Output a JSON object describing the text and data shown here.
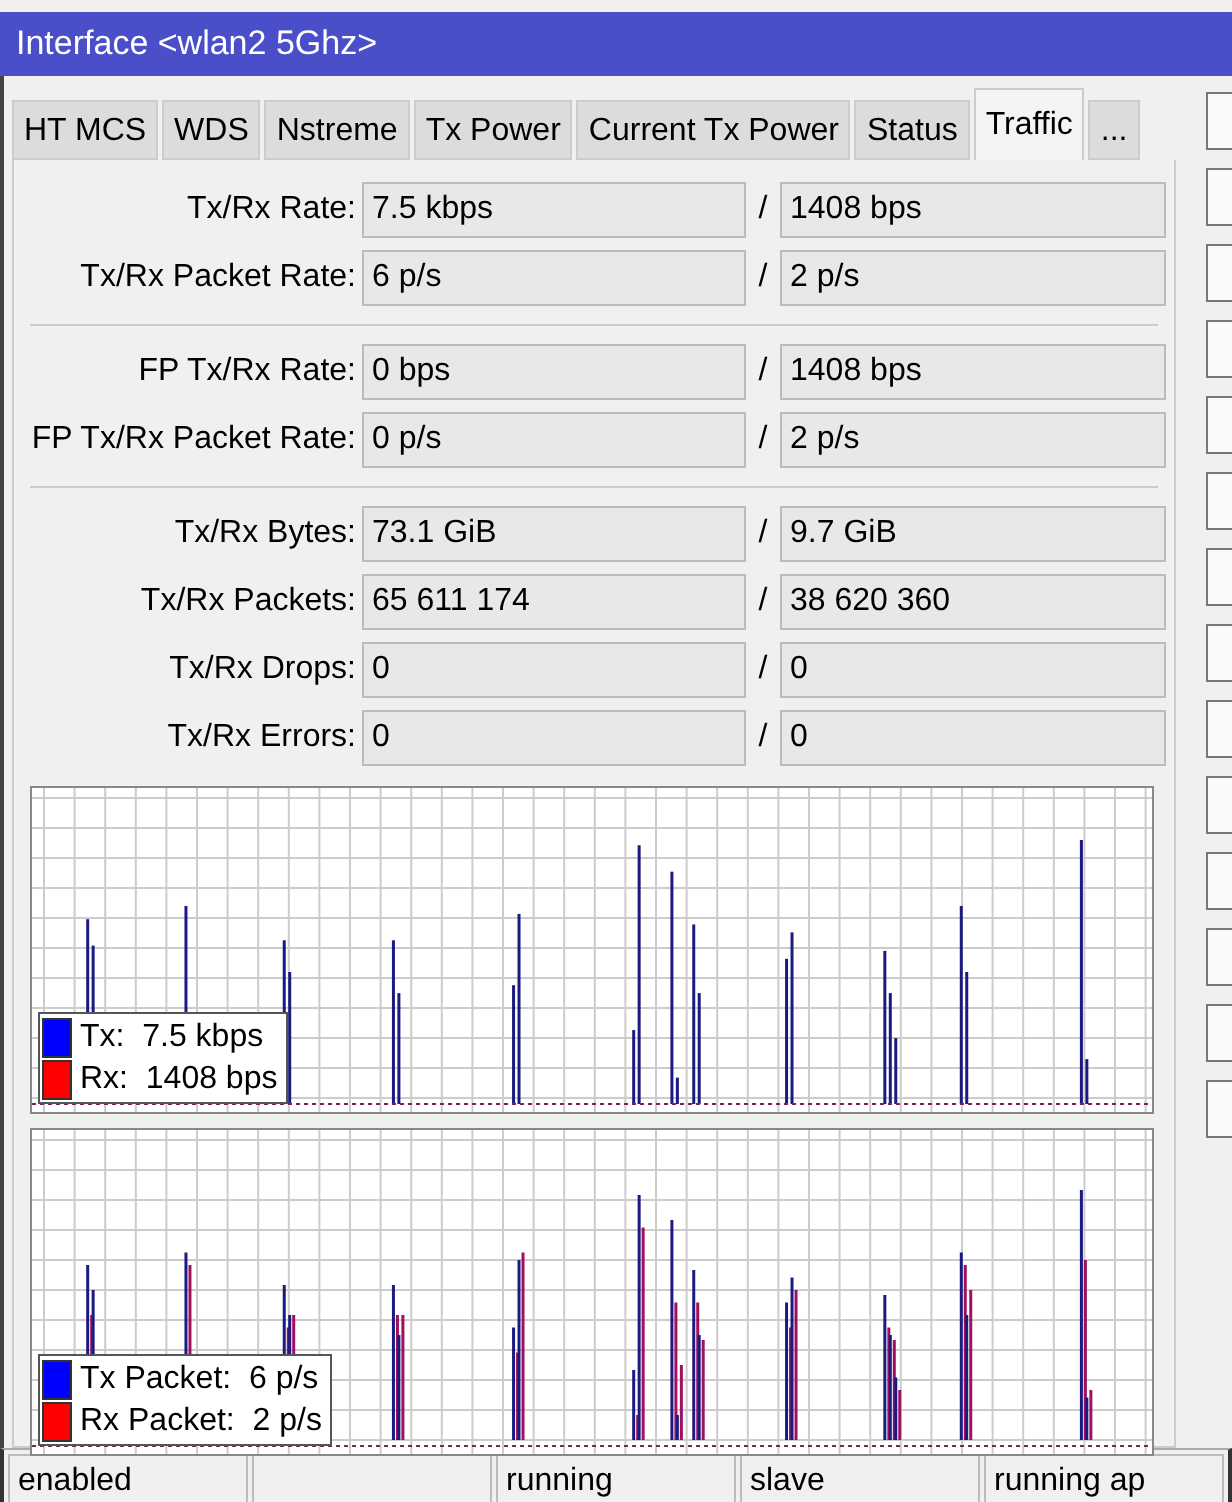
{
  "window": {
    "title": "Interface <wlan2 5Ghz>"
  },
  "tabs": [
    {
      "label": "HT MCS",
      "selected": false
    },
    {
      "label": "WDS",
      "selected": false
    },
    {
      "label": "Nstreme",
      "selected": false
    },
    {
      "label": "Tx Power",
      "selected": false
    },
    {
      "label": "Current Tx Power",
      "selected": false
    },
    {
      "label": "Status",
      "selected": false
    },
    {
      "label": "Traffic",
      "selected": true
    },
    {
      "label": "...",
      "selected": false
    }
  ],
  "groups": [
    [
      {
        "label": "Tx/Rx Rate:",
        "tx": "7.5 kbps",
        "separator": "/",
        "rx": "1408 bps"
      },
      {
        "label": "Tx/Rx Packet Rate:",
        "tx": "6 p/s",
        "separator": "/",
        "rx": "2 p/s"
      }
    ],
    [
      {
        "label": "FP Tx/Rx Rate:",
        "tx": "0 bps",
        "separator": "/",
        "rx": "1408 bps"
      },
      {
        "label": "FP Tx/Rx Packet Rate:",
        "tx": "0 p/s",
        "separator": "/",
        "rx": "2 p/s"
      }
    ],
    [
      {
        "label": "Tx/Rx Bytes:",
        "tx": "73.1 GiB",
        "separator": "/",
        "rx": "9.7 GiB"
      },
      {
        "label": "Tx/Rx Packets:",
        "tx": "65 611 174",
        "separator": "/",
        "rx": "38 620 360"
      },
      {
        "label": "Tx/Rx Drops:",
        "tx": "0",
        "separator": "/",
        "rx": "0"
      },
      {
        "label": "Tx/Rx Errors:",
        "tx": "0",
        "separator": "/",
        "rx": "0"
      }
    ]
  ],
  "graphs": [
    {
      "legend": [
        {
          "text": "Tx:  7.5 kbps",
          "color": "#0000ff"
        },
        {
          "text": "Rx:  1408 bps",
          "color": "#ff0000"
        }
      ]
    },
    {
      "legend": [
        {
          "text": "Tx Packet:  6 p/s",
          "color": "#0000ff"
        },
        {
          "text": "Rx Packet:  2 p/s",
          "color": "#ff0000"
        }
      ]
    }
  ],
  "status_bar": [
    {
      "kind": "text",
      "text": "enabled"
    },
    {
      "kind": "blank"
    },
    {
      "kind": "text",
      "text": "running"
    },
    {
      "kind": "text",
      "text": "slave"
    },
    {
      "kind": "text",
      "text": "running ap"
    }
  ]
}
